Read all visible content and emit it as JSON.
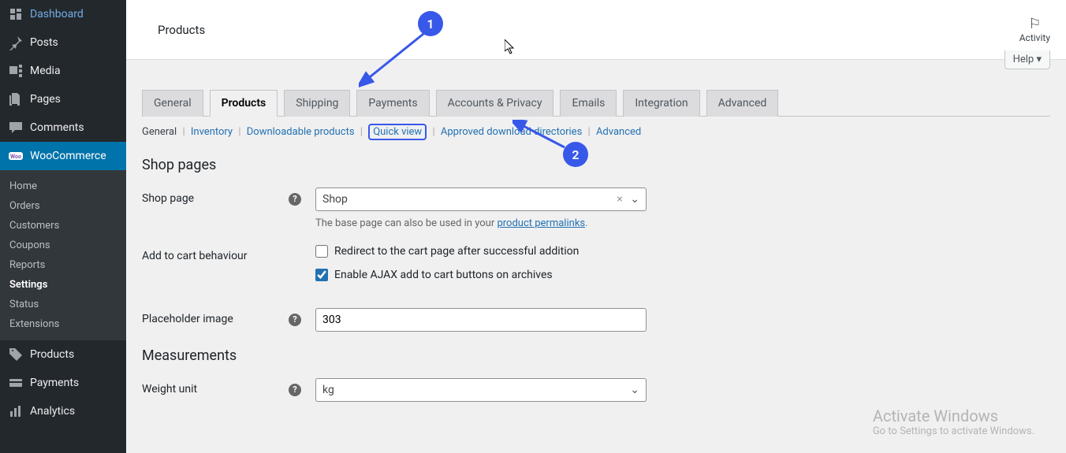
{
  "sidebar": {
    "items": [
      {
        "label": "Dashboard",
        "icon": "dashboard"
      },
      {
        "label": "Posts",
        "icon": "pin"
      },
      {
        "label": "Media",
        "icon": "media"
      },
      {
        "label": "Pages",
        "icon": "pages"
      },
      {
        "label": "Comments",
        "icon": "comments"
      },
      {
        "label": "WooCommerce",
        "icon": "woo",
        "active": true
      },
      {
        "label": "Products",
        "icon": "products"
      },
      {
        "label": "Payments",
        "icon": "payments"
      },
      {
        "label": "Analytics",
        "icon": "analytics"
      }
    ],
    "sub": [
      {
        "label": "Home"
      },
      {
        "label": "Orders"
      },
      {
        "label": "Customers"
      },
      {
        "label": "Coupons"
      },
      {
        "label": "Reports"
      },
      {
        "label": "Settings",
        "current": true
      },
      {
        "label": "Status"
      },
      {
        "label": "Extensions"
      }
    ]
  },
  "topbar": {
    "title": "Products",
    "activity_label": "Activity"
  },
  "help_label": "Help",
  "tabs": [
    {
      "label": "General"
    },
    {
      "label": "Products",
      "active": true
    },
    {
      "label": "Shipping"
    },
    {
      "label": "Payments"
    },
    {
      "label": "Accounts & Privacy"
    },
    {
      "label": "Emails"
    },
    {
      "label": "Integration"
    },
    {
      "label": "Advanced"
    }
  ],
  "subnav": {
    "items": [
      {
        "label": "General",
        "current": true
      },
      {
        "label": "Inventory"
      },
      {
        "label": "Downloadable products"
      },
      {
        "label": "Quick view",
        "boxed": true
      },
      {
        "label": "Approved download directories"
      },
      {
        "label": "Advanced"
      }
    ]
  },
  "sections": {
    "shop_pages": "Shop pages",
    "measurements": "Measurements"
  },
  "form": {
    "shop_page": {
      "label": "Shop page",
      "value": "Shop",
      "desc_prefix": "The base page can also be used in your ",
      "desc_link": "product permalinks",
      "desc_suffix": "."
    },
    "add_to_cart": {
      "label": "Add to cart behaviour",
      "opt1": "Redirect to the cart page after successful addition",
      "opt2": "Enable AJAX add to cart buttons on archives"
    },
    "placeholder": {
      "label": "Placeholder image",
      "value": "303"
    },
    "weight": {
      "label": "Weight unit",
      "value": "kg"
    }
  },
  "annotations": {
    "one": "1",
    "two": "2"
  },
  "watermark": {
    "line1": "Activate Windows",
    "line2": "Go to Settings to activate Windows."
  }
}
